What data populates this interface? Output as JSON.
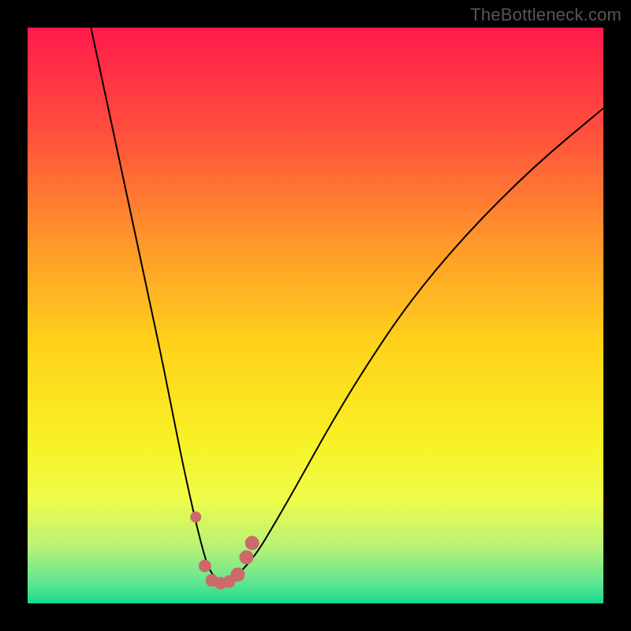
{
  "watermark": "TheBottleneck.com",
  "colors": {
    "frame": "#000000",
    "watermark_text": "#565656",
    "curve": "#000000",
    "marker": "#cc6a6a"
  },
  "chart_data": {
    "type": "line",
    "title": "",
    "xlabel": "",
    "ylabel": "",
    "xlim": [
      0,
      100
    ],
    "ylim": [
      0,
      100
    ],
    "background_gradient": {
      "stops": [
        {
          "offset": 0.0,
          "color": "#ff1a4b"
        },
        {
          "offset": 0.18,
          "color": "#ff4e3d"
        },
        {
          "offset": 0.38,
          "color": "#ff9a2a"
        },
        {
          "offset": 0.55,
          "color": "#ffd21a"
        },
        {
          "offset": 0.72,
          "color": "#f8f126"
        },
        {
          "offset": 0.82,
          "color": "#eefc4a"
        },
        {
          "offset": 0.9,
          "color": "#baf276"
        },
        {
          "offset": 0.96,
          "color": "#67e790"
        },
        {
          "offset": 1.0,
          "color": "#18db8d"
        }
      ]
    },
    "series": [
      {
        "name": "bottleneck-curve",
        "x": [
          11,
          14,
          17,
          20,
          23,
          25,
          27,
          29,
          30.5,
          31.5,
          32.5,
          33.5,
          34.5,
          36,
          37.5,
          40,
          43,
          47,
          52,
          58,
          66,
          76,
          88,
          100
        ],
        "y": [
          100,
          86,
          72,
          58,
          44,
          34,
          24,
          15,
          9,
          6,
          4.5,
          4,
          4,
          4.5,
          6,
          9,
          14,
          21,
          30,
          40,
          52,
          64,
          76,
          86
        ]
      }
    ],
    "markers": {
      "name": "highlight-points",
      "points": [
        {
          "x": 29.2,
          "y": 15.0,
          "r": 7
        },
        {
          "x": 30.8,
          "y": 6.5,
          "r": 8
        },
        {
          "x": 32.0,
          "y": 4.0,
          "r": 8
        },
        {
          "x": 33.5,
          "y": 3.5,
          "r": 8
        },
        {
          "x": 35.0,
          "y": 3.8,
          "r": 8
        },
        {
          "x": 36.5,
          "y": 5.0,
          "r": 9
        },
        {
          "x": 38.0,
          "y": 8.0,
          "r": 9
        },
        {
          "x": 39.0,
          "y": 10.5,
          "r": 9
        }
      ]
    }
  }
}
